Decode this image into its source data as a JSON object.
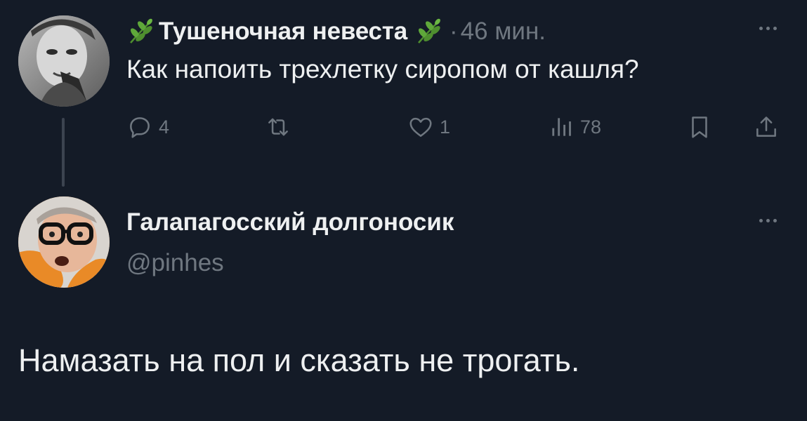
{
  "tweet": {
    "author_name": "Тушеночная невеста",
    "author_decoration_icon": "herb-leaf-icon",
    "separator": "·",
    "time": "46 мин.",
    "text": "Как напоить трехлетку сиропом от кашля?",
    "stats": {
      "replies": "4",
      "likes": "1",
      "views": "78"
    }
  },
  "reply": {
    "author_name": "Галапагосский долгоносик",
    "handle": "@pinhes",
    "text": "Намазать на пол и сказать не трогать."
  },
  "colors": {
    "background": "#141b27",
    "text_primary": "#eef0f1",
    "text_secondary": "#6f7780",
    "thread_line": "#3c4450",
    "leaf_green": "#4f8f2f"
  }
}
